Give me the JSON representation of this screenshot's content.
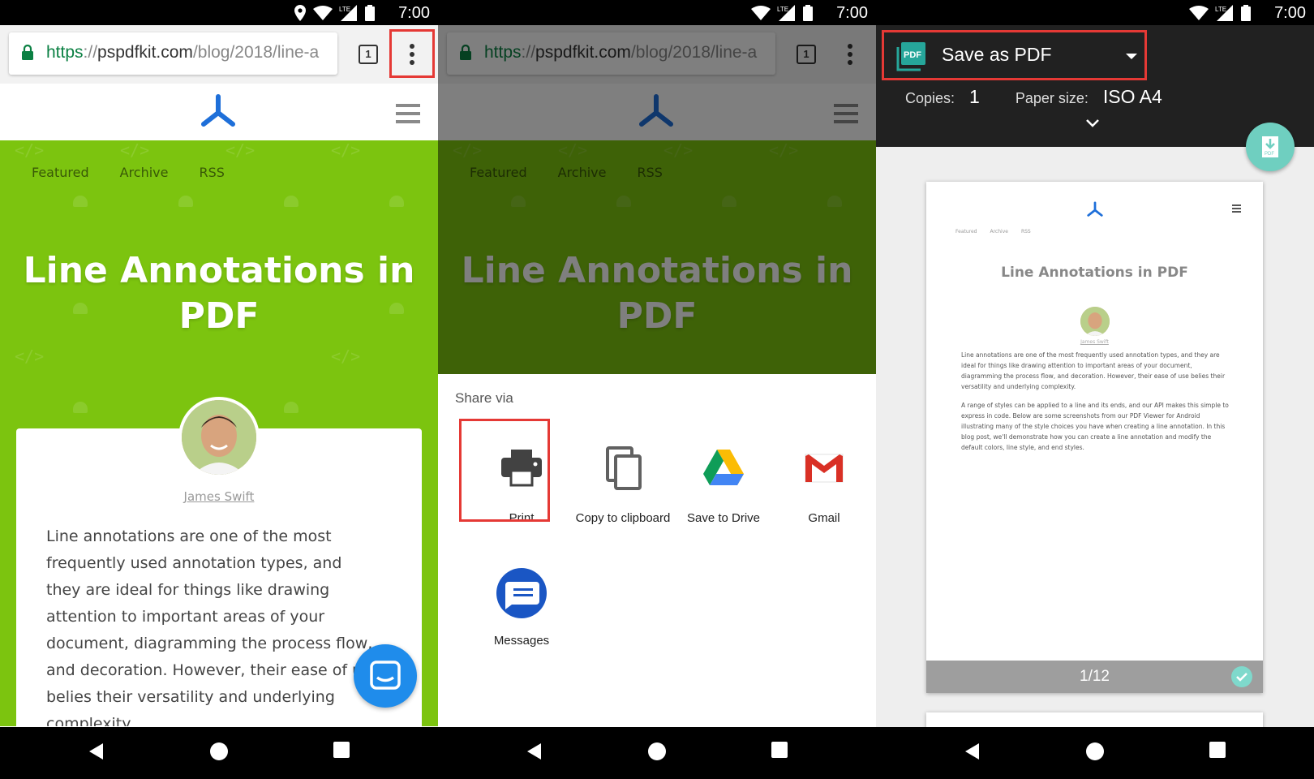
{
  "status": {
    "time": "7:00",
    "network": "LTE"
  },
  "browser": {
    "url_scheme": "https",
    "url_sep": "://",
    "url_host": "pspdfkit.com",
    "url_path": "/blog/2018/line-a",
    "tab_count": "1"
  },
  "site": {
    "nav": [
      "Featured",
      "Archive",
      "RSS"
    ],
    "title_line1": "Line Annotations in",
    "title_line2": "PDF",
    "author": "James Swift",
    "paragraph_lines": [
      "Line annotations are one of the most",
      "frequently used annotation types, and",
      "they are ideal for things like drawing",
      "attention to important areas of your",
      "document, diagramming the process flow,",
      "and decoration. However, their ease of use",
      "belies their versatility and underlying",
      "complexity."
    ]
  },
  "share": {
    "title": "Share via",
    "items": [
      {
        "label": "Print",
        "icon": "printer-icon"
      },
      {
        "label": "Copy to clipboard",
        "icon": "copy-icon"
      },
      {
        "label": "Save to Drive",
        "icon": "google-drive-icon"
      },
      {
        "label": "Gmail",
        "icon": "gmail-icon"
      },
      {
        "label": "Messages",
        "icon": "messages-icon"
      }
    ]
  },
  "print": {
    "destination": "Save as PDF",
    "copies_label": "Copies:",
    "copies_value": "1",
    "paper_label": "Paper size:",
    "paper_value": "ISO A4",
    "page_indicator": "1/12",
    "preview_title": "Line Annotations in PDF",
    "preview_author": "James Swift",
    "preview_p1": "Line annotations are one of the most frequently used annotation types, and they are ideal for things like drawing attention to important areas of your document, diagramming the process flow, and decoration. However, their ease of use belies their versatility and underlying complexity.",
    "preview_p2": "A range of styles can be applied to a line and its ends, and our API makes this simple to express in code. Below are some screenshots from our PDF Viewer for Android illustrating many of the style choices you have when creating a line annotation. In this blog post, we'll demonstrate how you can create a line annotation and modify the default colors, line style, and end styles."
  },
  "colors": {
    "brand_green": "#7cc40f",
    "highlight_red": "#e53935",
    "fab_blue": "#1f8ceb",
    "fab_teal": "#6fcfc0"
  }
}
